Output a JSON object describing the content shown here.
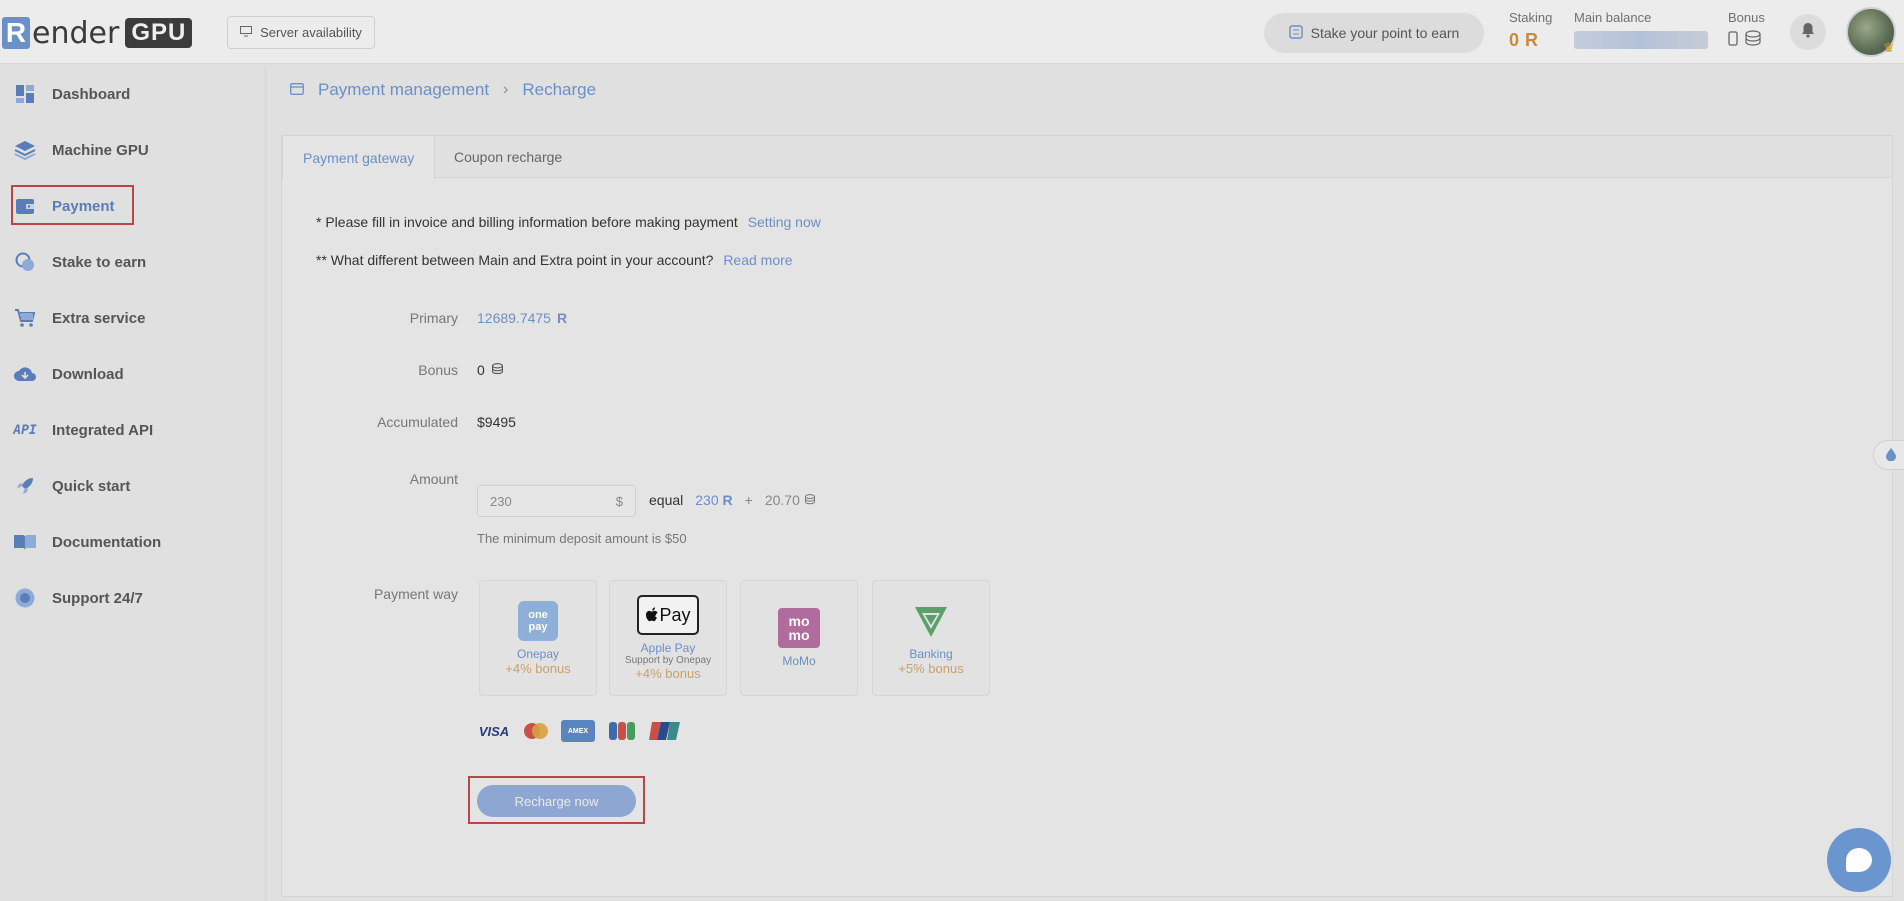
{
  "topbar": {
    "logo_r": "R",
    "logo_ender": "ender",
    "logo_gpu": "GPU",
    "server_availability": "Server availability",
    "stake_pill": "Stake your point to earn",
    "staking_label": "Staking",
    "staking_value": "0",
    "staking_unit": "R",
    "main_balance_label": "Main balance",
    "bonus_label": "Bonus"
  },
  "sidebar": {
    "items": [
      {
        "label": "Dashboard",
        "icon": "dashboard-icon"
      },
      {
        "label": "Machine GPU",
        "icon": "layers-icon"
      },
      {
        "label": "Payment",
        "icon": "wallet-icon"
      },
      {
        "label": "Stake to earn",
        "icon": "coins-icon"
      },
      {
        "label": "Extra service",
        "icon": "cart-icon"
      },
      {
        "label": "Download",
        "icon": "cloud-download-icon"
      },
      {
        "label": "Integrated API",
        "icon": "api-icon"
      },
      {
        "label": "Quick start",
        "icon": "rocket-icon"
      },
      {
        "label": "Documentation",
        "icon": "book-icon"
      },
      {
        "label": "Support 24/7",
        "icon": "support-icon"
      }
    ]
  },
  "breadcrumb": {
    "parent": "Payment management",
    "current": "Recharge"
  },
  "tabs": {
    "payment_gateway": "Payment gateway",
    "coupon_recharge": "Coupon recharge"
  },
  "notes": {
    "billing_text": "* Please fill in invoice and billing information before making payment",
    "billing_link": "Setting now",
    "difference_text": "** What different between Main and Extra point in your account?",
    "difference_link": "Read more"
  },
  "balances": {
    "primary_label": "Primary",
    "primary_value": "12689.7475",
    "bonus_label": "Bonus",
    "bonus_value": "0",
    "accumulated_label": "Accumulated",
    "accumulated_value": "$9495"
  },
  "amount": {
    "label": "Amount",
    "value": "230",
    "currency": "$",
    "equal_label": "equal",
    "primary_equiv": "230",
    "plus": "+",
    "bonus_equiv": "20.70",
    "min_note": "The minimum deposit amount is $50"
  },
  "payment_way": {
    "label": "Payment way",
    "options": [
      {
        "name": "Onepay",
        "sub": "",
        "bonus": "+4% bonus",
        "logo_text": "one pay"
      },
      {
        "name": "Apple Pay",
        "sub": "Support by Onepay",
        "bonus": "+4% bonus",
        "logo_text": "Pay"
      },
      {
        "name": "MoMo",
        "sub": "",
        "bonus": "",
        "logo_text": "mo mo"
      },
      {
        "name": "Banking",
        "sub": "",
        "bonus": "+5% bonus",
        "logo_text": ""
      }
    ],
    "cards": [
      "VISA",
      "Mastercard",
      "AMEX",
      "JCB",
      "UnionPay"
    ]
  },
  "actions": {
    "recharge": "Recharge now"
  },
  "colors": {
    "accent": "#6b8fc7",
    "highlight": "#b9474a",
    "bonus": "#c8a06a"
  }
}
